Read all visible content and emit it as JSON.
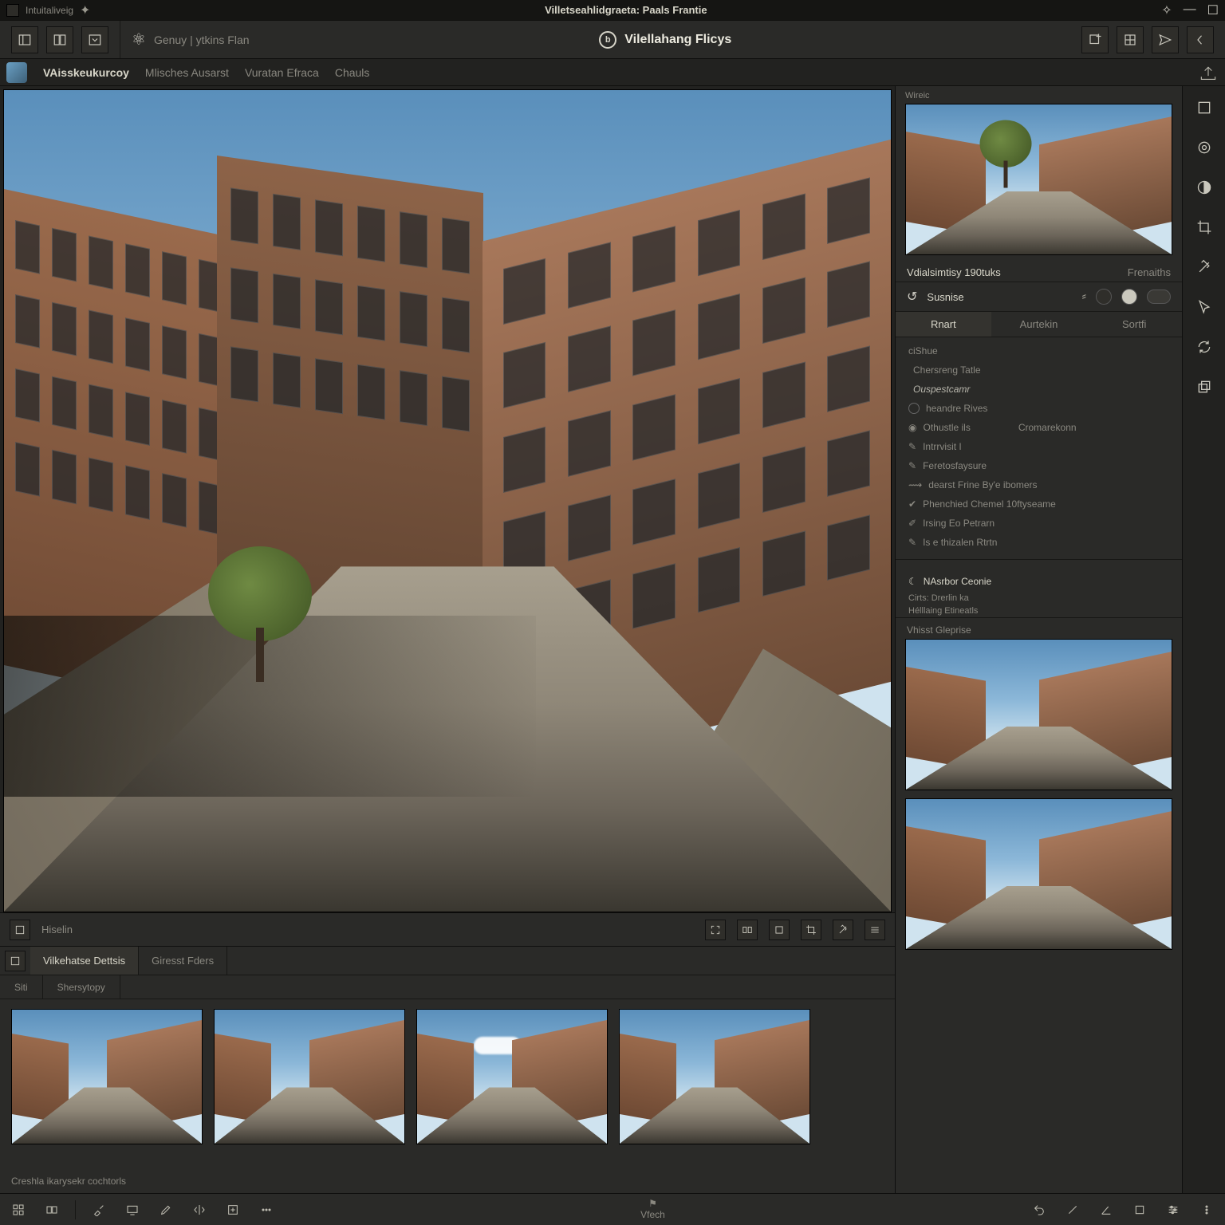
{
  "titlebar": {
    "app_name": "Intuitaliveig",
    "doc_title": "Villetseahlidgraeta: Paals Frantie"
  },
  "toolbar": {
    "workspace": "Genuy | ytkins Flan",
    "center": "Vilellahang Flicys"
  },
  "menubar": {
    "items": [
      "VAisskeukurcoy",
      "Mlisches Ausarst",
      "Vuratan Efraca",
      "Chauls"
    ]
  },
  "canvas_bar": {
    "label": "Hiselin"
  },
  "bottom": {
    "tabs": [
      "Vilkehatse Dettsis",
      "Giresst Fders"
    ],
    "sub": [
      "Siti",
      "Shersytopy"
    ],
    "footer": "Creshla ikarysekr cochtorls"
  },
  "right": {
    "panel": "Wireic",
    "header_left": "Vdialsimtisy 190tuks",
    "header_right": "Frenaiths",
    "toggle": "Susnise",
    "tabs": [
      "Rnart",
      "Aurtekin",
      "Sortfi"
    ],
    "section": {
      "title": "ciShue",
      "sub1": "Chersreng Tatle",
      "em": "Ouspestcamr",
      "chk1": "heandre Rives",
      "left_opt": "Othustle ils",
      "right_opt": "Cromarekonn",
      "it1": "Intrrvisit I",
      "it2": "Feretosfaysure",
      "slider": "dearst Frine By'e ibomers",
      "long": "Phenchied Chemel 10ftyseame",
      "pen": "Irsing Eo Petrarn",
      "art": "Is e thizalen Rtrtn"
    },
    "note": "NAsrbor Ceonie",
    "meta1": "Cirts: Drerlin ka",
    "meta2": "Hélllaing Etineatls",
    "gallery": "Vhisst Gleprise"
  },
  "status": {
    "center": "Vfech"
  }
}
